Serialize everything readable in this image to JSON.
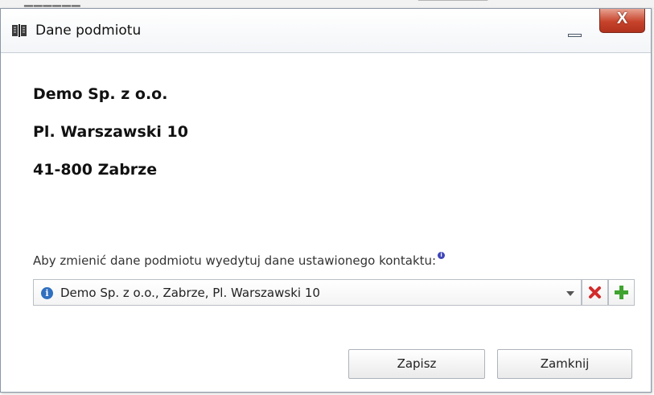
{
  "window": {
    "title": "Dane podmiotu",
    "close_label": "X"
  },
  "entity": {
    "name": "Demo Sp. z o.o.",
    "street": "Pl. Warszawski 10",
    "city": "41-800 Zabrze"
  },
  "contact": {
    "hint": "Aby zmienić dane podmiotu wyedytuj dane ustawionego kontaktu:",
    "selected": "Demo Sp. z o.o., Zabrze, Pl. Warszawski 10"
  },
  "buttons": {
    "save": "Zapisz",
    "close": "Zamknij"
  },
  "colors": {
    "close_button": "#c7432b",
    "remove_icon": "#d22b2b",
    "add_icon": "#3fa32f",
    "info_icon": "#2f6fbf"
  },
  "icons": {
    "app": "book-icon",
    "minimize": "minimize-icon",
    "close": "close-icon",
    "info": "info-icon",
    "dropdown": "chevron-down-icon",
    "remove": "remove-icon",
    "add": "add-icon"
  }
}
